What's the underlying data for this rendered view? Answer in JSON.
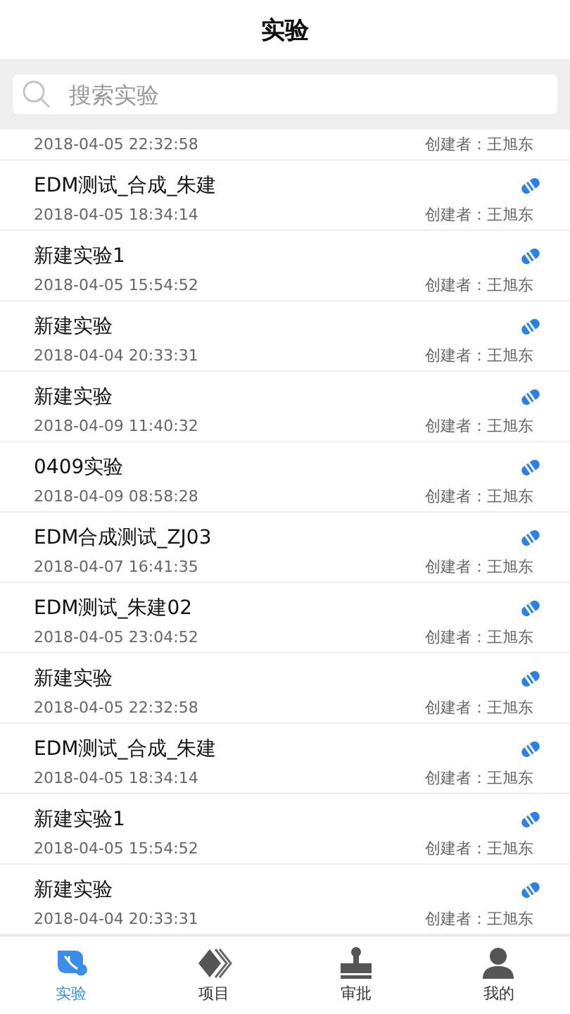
{
  "header": {
    "title": "实验"
  },
  "search": {
    "placeholder": "搜索实验"
  },
  "items": [
    {
      "date": "2018-04-05 22:32:58",
      "creator": "创建者：王旭东"
    },
    {
      "title": "EDM测试_合成_朱建",
      "date": "2018-04-05 18:34:14",
      "creator": "创建者：王旭东"
    },
    {
      "title": "新建实验1",
      "date": "2018-04-05 15:54:52",
      "creator": "创建者：王旭东"
    },
    {
      "title": "新建实验",
      "date": "2018-04-04 20:33:31",
      "creator": "创建者：王旭东"
    },
    {
      "title": "新建实验",
      "date": "2018-04-09 11:40:32",
      "creator": "创建者：王旭东"
    },
    {
      "title": "0409实验",
      "date": "2018-04-09 08:58:28",
      "creator": "创建者：王旭东"
    },
    {
      "title": "EDM合成测试_ZJ03",
      "date": "2018-04-07 16:41:35",
      "creator": "创建者：王旭东"
    },
    {
      "title": "EDM测试_朱建02",
      "date": "2018-04-05 23:04:52",
      "creator": "创建者：王旭东"
    },
    {
      "title": "新建实验",
      "date": "2018-04-05 22:32:58",
      "creator": "创建者：王旭东"
    },
    {
      "title": "EDM测试_合成_朱建",
      "date": "2018-04-05 18:34:14",
      "creator": "创建者：王旭东"
    },
    {
      "title": "新建实验1",
      "date": "2018-04-05 15:54:52",
      "creator": "创建者：王旭东"
    },
    {
      "title": "新建实验",
      "date": "2018-04-04 20:33:31",
      "creator": "创建者：王旭东"
    }
  ],
  "tabs": [
    {
      "label": "实验",
      "kind": "leaf",
      "selected": true
    },
    {
      "label": "项目",
      "kind": "layers",
      "selected": false
    },
    {
      "label": "审批",
      "kind": "stamp",
      "selected": false
    },
    {
      "label": "我的",
      "kind": "person",
      "selected": false
    }
  ]
}
